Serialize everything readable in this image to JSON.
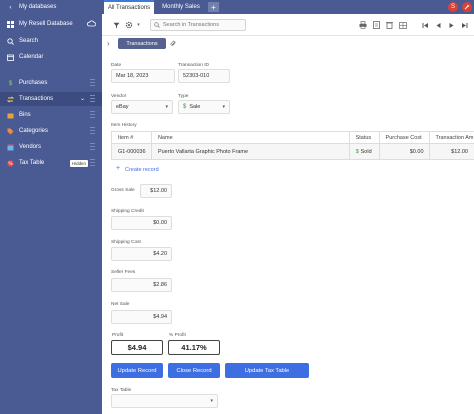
{
  "sidebar": {
    "header": "My databases",
    "database": "My Resell Database",
    "search": "Search",
    "calendar": "Calendar",
    "tables": [
      {
        "label": "Purchases"
      },
      {
        "label": "Transactions"
      },
      {
        "label": "Bins"
      },
      {
        "label": "Categories"
      },
      {
        "label": "Vendors"
      },
      {
        "label": "Tax Table",
        "badge": "Hidden"
      }
    ]
  },
  "tabs": [
    "All Transactions",
    "Monthly Sales"
  ],
  "add_tab": "+",
  "user_initial": "S",
  "search": {
    "placeholder": "Search in Transactions"
  },
  "subbar": {
    "pill": "Transactions"
  },
  "form": {
    "date_label": "Date",
    "date_value": "Mar 18, 2023",
    "txn_id_label": "Transaction ID",
    "txn_id_value": "52303-010",
    "vendor_label": "Vendor",
    "vendor_value": "eBay",
    "type_label": "Type",
    "type_value": "Sale",
    "item_history_label": "Item History",
    "table_headers": [
      "Item #",
      "Name",
      "Status",
      "Purchase Cost",
      "Transaction Am"
    ],
    "table_rows": [
      {
        "item": "G1-000036",
        "name": "Puerto Vallarta Graphic Photo Frame",
        "status": "Sold",
        "purchase_cost": "$0.00",
        "amount": "$12.00"
      }
    ],
    "create_record": "Create record",
    "gross_sale_label": "Gross Sale",
    "gross_sale_value": "$12.00",
    "shipping_credit_label": "Shipping Credit",
    "shipping_credit_value": "$0.00",
    "shipping_cost_label": "Shipping Cost",
    "shipping_cost_value": "$4.20",
    "seller_fees_label": "Seller Fees",
    "seller_fees_value": "$2.86",
    "net_sale_label": "Net Sale",
    "net_sale_value": "$4.94",
    "profit_label": "Profit",
    "profit_value": "$4.94",
    "pct_profit_label": "% Profit",
    "pct_profit_value": "41.17%",
    "buttons": {
      "update_record": "Update Record",
      "close_record": "Close Record",
      "update_tax_table": "Update Tax Table"
    },
    "tax_table_label": "Tax Table",
    "tax_table_value": ""
  },
  "colors": {
    "sidebar": "#4a5a93",
    "accent": "#3d6fe3",
    "avatar": "#d9413a"
  }
}
